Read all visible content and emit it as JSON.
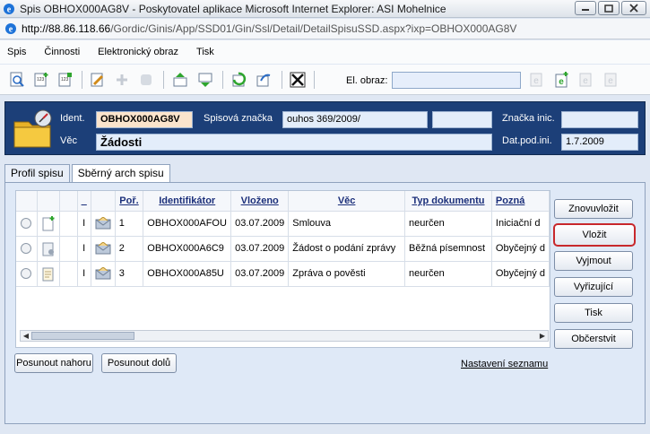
{
  "window": {
    "title": "Spis OBHOX000AG8V - Poskytovatel aplikace Microsoft Internet Explorer: ASI Mohelnice",
    "url_host": "http://88.86.118.66",
    "url_path": "/Gordic/Ginis/App/SSD01/Gin/Ssl/Detail/DetailSpisuSSD.aspx?ixp=OBHOX000AG8V"
  },
  "menu": [
    "Spis",
    "Činnosti",
    "Elektronický obraz",
    "Tisk"
  ],
  "toolbar": {
    "el_obraz_label": "El. obraz:",
    "el_obraz_value": ""
  },
  "header": {
    "ident_label": "Ident.",
    "ident_value": "OBHOX000AG8V",
    "spisova_label": "Spisová značka",
    "spisova_value": "ouhos 369/2009/",
    "spisova_extra": "",
    "znacka_label": "Značka inic.",
    "znacka_value": "",
    "vec_label": "Věc",
    "vec_value": "Žádosti",
    "datpod_label": "Dat.pod.ini.",
    "datpod_value": "1.7.2009"
  },
  "tabs": [
    "Profil spisu",
    "Sběrný arch spisu"
  ],
  "grid": {
    "columns": [
      "_",
      "Poř.",
      "Identifikátor",
      "Vloženo",
      "Věc",
      "Typ dokumentu",
      "Pozná"
    ],
    "rows": [
      {
        "flag": "I",
        "order": "1",
        "id": "OBHOX000AFOU",
        "date": "03.07.2009",
        "vec": "Smlouva",
        "typ": "neurčen",
        "pozn": "Iniciační d"
      },
      {
        "flag": "I",
        "order": "2",
        "id": "OBHOX000A6C9",
        "date": "03.07.2009",
        "vec": "Žádost o podání zprávy",
        "typ": "Běžná písemnost",
        "pozn": "Obyčejný d"
      },
      {
        "flag": "I",
        "order": "3",
        "id": "OBHOX000A85U",
        "date": "03.07.2009",
        "vec": "Zpráva o pověsti",
        "typ": "neurčen",
        "pozn": "Obyčejný d"
      }
    ]
  },
  "side_buttons": [
    "Znovuvložit",
    "Vložit",
    "Vyjmout",
    "Vyřizující",
    "Tisk",
    "Občerstvit"
  ],
  "bottom": {
    "up": "Posunout nahoru",
    "down": "Posunout dolů",
    "settings": "Nastavení seznamu"
  }
}
